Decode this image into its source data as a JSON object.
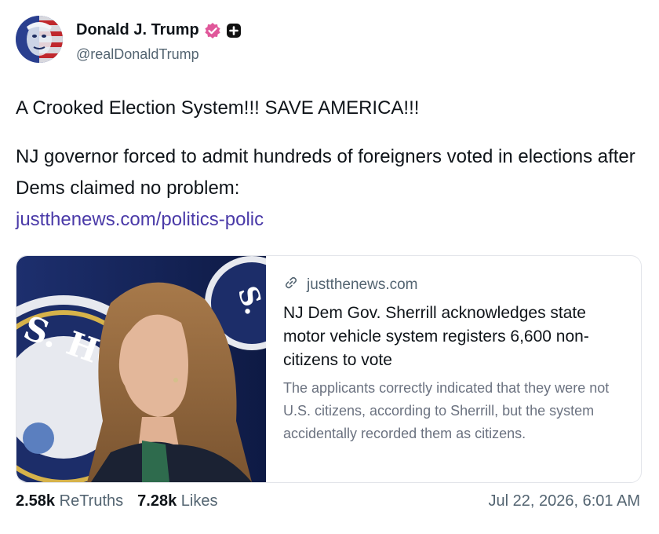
{
  "author": {
    "name": "Donald J. Trump",
    "handle": "@realDonaldTrump",
    "avatar_icon": "avatar-image",
    "verified_icon": "verified-badge-icon",
    "plus_icon": "plus-badge-icon"
  },
  "post": {
    "line1": "A Crooked Election System!!! SAVE AMERICA!!!",
    "paragraph2": "NJ governor forced to admit hundreds of foreigners voted in elections after Dems claimed no problem:",
    "link_text": "justthenews.com/politics-polic"
  },
  "link_card": {
    "domain": "justthenews.com",
    "link_icon": "link-icon",
    "title": "NJ Dem Gov. Sherrill acknowledges state motor vehicle system registers 6,600 non-citizens to vote",
    "description": "The applicants correctly indicated that they were not U.S. citizens, according to Sherrill, but the system accidentally recorded them as citizens."
  },
  "stats": {
    "retruths_count": "2.58k",
    "retruths_label": "ReTruths",
    "likes_count": "7.28k",
    "likes_label": "Likes"
  },
  "timestamp": "Jul 22, 2026, 6:01 AM",
  "colors": {
    "link": "#4a3aa8",
    "verified": "#e0579a",
    "secondary_text": "#536471"
  }
}
